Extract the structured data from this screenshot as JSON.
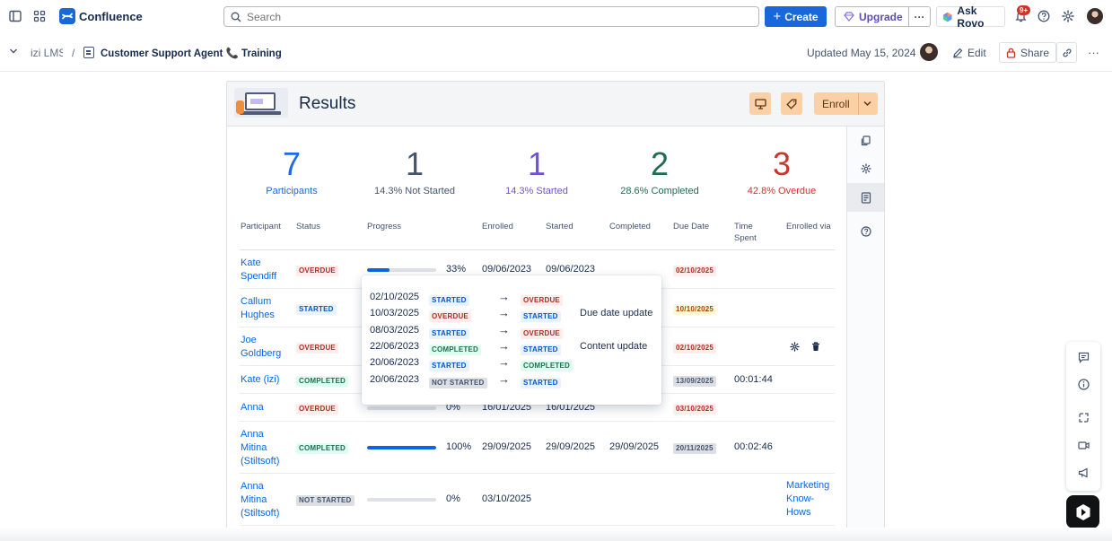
{
  "topnav": {
    "logo": "Confluence",
    "search_placeholder": "Search",
    "create": "Create",
    "upgrade": "Upgrade",
    "more": "···",
    "ask_rovo": "Ask Rovo",
    "notif_badge": "9+"
  },
  "breadcrumb": {
    "space": "izi LMS",
    "separator": "/",
    "page_title": "Customer Support Agent 📞 Training",
    "updated": "Updated May 15, 2024",
    "edit": "Edit",
    "share": "Share",
    "more": "···"
  },
  "macro": {
    "title": "Results",
    "enroll": "Enroll"
  },
  "stats": [
    {
      "num": "7",
      "label": "Participants",
      "color": "#1d6ae5"
    },
    {
      "num": "1",
      "label": "14.3% Not Started",
      "color": "#44546f"
    },
    {
      "num": "1",
      "label": "14.3% Started",
      "color": "#6f52d5"
    },
    {
      "num": "2",
      "label": "28.6% Completed",
      "color": "#216e4e"
    },
    {
      "num": "3",
      "label": "42.8% Overdue",
      "color": "#c9372c"
    }
  ],
  "table": {
    "headers": [
      "Participant",
      "Status",
      "Progress",
      "Enrolled",
      "Started",
      "Completed",
      "Due Date",
      "Time Spent",
      "Enrolled via"
    ],
    "rows": [
      {
        "name": "Kate Spendiff",
        "status": "OVERDUE",
        "progress": 33,
        "progress_text": "33%",
        "enrolled": "09/06/2023",
        "started": "09/06/2023",
        "completed": "",
        "due": "02/10/2025",
        "time": "",
        "via": ""
      },
      {
        "name": "Callum Hughes",
        "status": "STARTED",
        "progress": 0,
        "progress_text": "",
        "enrolled": "",
        "started": "",
        "completed": "",
        "due": "10/10/2025",
        "time": "",
        "via": ""
      },
      {
        "name": "Joe Goldberg",
        "status": "OVERDUE",
        "progress": 0,
        "progress_text": "",
        "enrolled": "",
        "started": "",
        "completed": "",
        "due": "02/10/2025",
        "time": "",
        "via": ""
      },
      {
        "name": "Kate (izi)",
        "status": "COMPLETED",
        "progress": 0,
        "progress_text": "",
        "enrolled": "",
        "started": "",
        "completed": "",
        "due": "13/09/2025",
        "time": "00:01:44",
        "via": ""
      },
      {
        "name": "Anna",
        "status": "OVERDUE",
        "progress": 0,
        "progress_text": "0%",
        "enrolled": "16/01/2025",
        "started": "16/01/2025",
        "completed": "",
        "due": "03/10/2025",
        "time": "",
        "via": ""
      },
      {
        "name": "Anna Mitina (Stiltsoft)",
        "status": "COMPLETED",
        "progress": 100,
        "progress_text": "100%",
        "enrolled": "29/09/2025",
        "started": "29/09/2025",
        "completed": "29/09/2025",
        "due": "20/11/2025",
        "time": "00:02:46",
        "via": ""
      },
      {
        "name": "Anna Mitina (Stiltsoft)",
        "status": "NOT STARTED",
        "progress": 0,
        "progress_text": "0%",
        "enrolled": "03/10/2025",
        "started": "",
        "completed": "",
        "due": "",
        "time": "",
        "via": "Marketing Know-Hows"
      }
    ]
  },
  "history_popup": {
    "rows": [
      {
        "date": "02/10/2025",
        "from": "STARTED",
        "to": "OVERDUE",
        "note": ""
      },
      {
        "date": "10/03/2025",
        "from": "OVERDUE",
        "to": "STARTED",
        "note": "Due date update"
      },
      {
        "date": "08/03/2025",
        "from": "STARTED",
        "to": "OVERDUE",
        "note": ""
      },
      {
        "date": "22/06/2023",
        "from": "COMPLETED",
        "to": "STARTED",
        "note": "Content update"
      },
      {
        "date": "20/06/2023",
        "from": "STARTED",
        "to": "COMPLETED",
        "note": ""
      },
      {
        "date": "20/06/2023",
        "from": "NOT STARTED",
        "to": "STARTED",
        "note": ""
      }
    ],
    "arrow": "→"
  }
}
